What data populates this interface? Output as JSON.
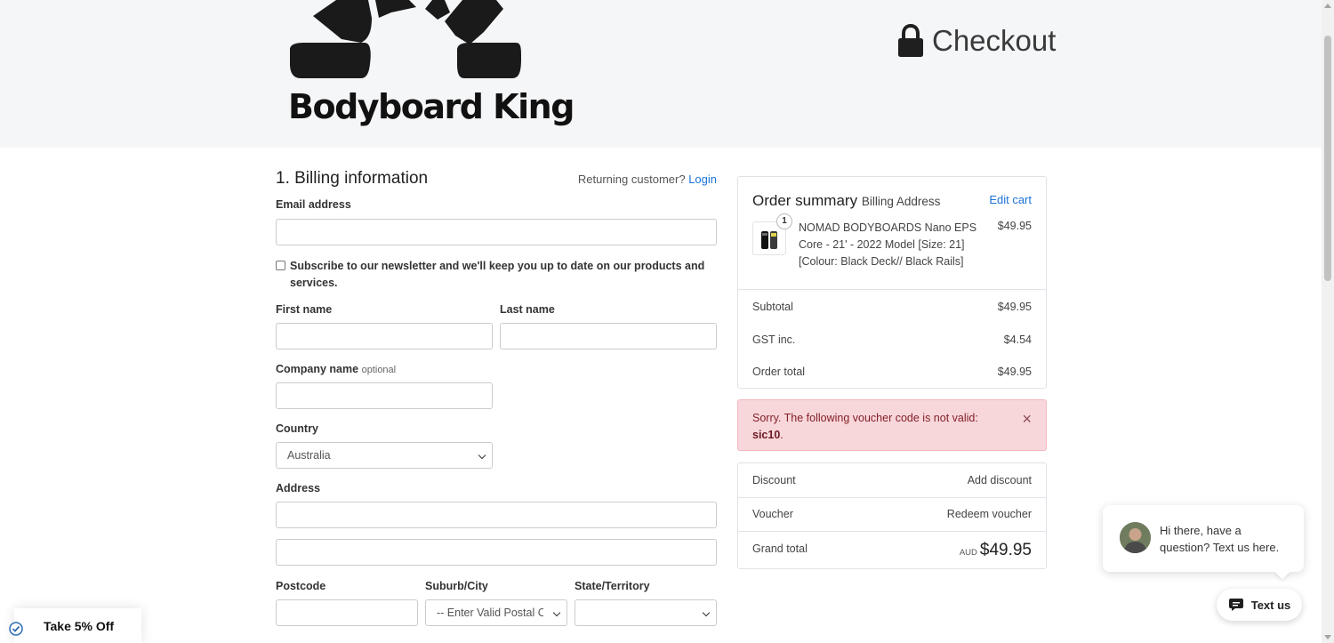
{
  "header": {
    "logo_text": "Bodyboard King",
    "checkout_title": "Checkout"
  },
  "billing": {
    "heading": "1. Billing information",
    "returning_text": "Returning customer?",
    "login_label": "Login",
    "email_label": "Email address",
    "email_value": "",
    "newsletter_label": "Subscribe to our newsletter and we'll keep you up to date on our products and services.",
    "newsletter_checked": false,
    "first_name_label": "First name",
    "last_name_label": "Last name",
    "company_label": "Company name",
    "company_optional": "optional",
    "country_label": "Country",
    "country_value": "Australia",
    "address_label": "Address",
    "postcode_label": "Postcode",
    "suburb_label": "Suburb/City",
    "suburb_value": "-- Enter Valid Postal Code --",
    "state_label": "State/Territory",
    "state_value": ""
  },
  "summary": {
    "title": "Order summary",
    "subtitle": "Billing Address",
    "edit_cart": "Edit cart",
    "item": {
      "qty": "1",
      "name": "NOMAD BODYBOARDS Nano EPS Core - 21' - 2022 Model [Size: 21] [Colour: Black Deck// Black Rails]",
      "price": "$49.95"
    },
    "subtotal_label": "Subtotal",
    "subtotal_value": "$49.95",
    "gst_label": "GST inc.",
    "gst_value": "$4.54",
    "order_total_label": "Order total",
    "order_total_value": "$49.95"
  },
  "alert": {
    "message": "Sorry. The following voucher code is not valid:",
    "code": "sic10",
    "suffix": ".",
    "close": "×"
  },
  "totals": {
    "discount_label": "Discount",
    "discount_action": "Add discount",
    "voucher_label": "Voucher",
    "voucher_action": "Redeem voucher",
    "grand_label": "Grand total",
    "currency": "AUD",
    "grand_value": "$49.95"
  },
  "chat": {
    "message": "Hi there, have a question? Text us here.",
    "button": "Text us"
  },
  "promo": {
    "label": "Take 5% Off"
  },
  "colors": {
    "link": "#1a73d9",
    "alert_bg": "#f8d7da",
    "alert_text": "#842029",
    "header_bg": "#f5f6f8"
  }
}
